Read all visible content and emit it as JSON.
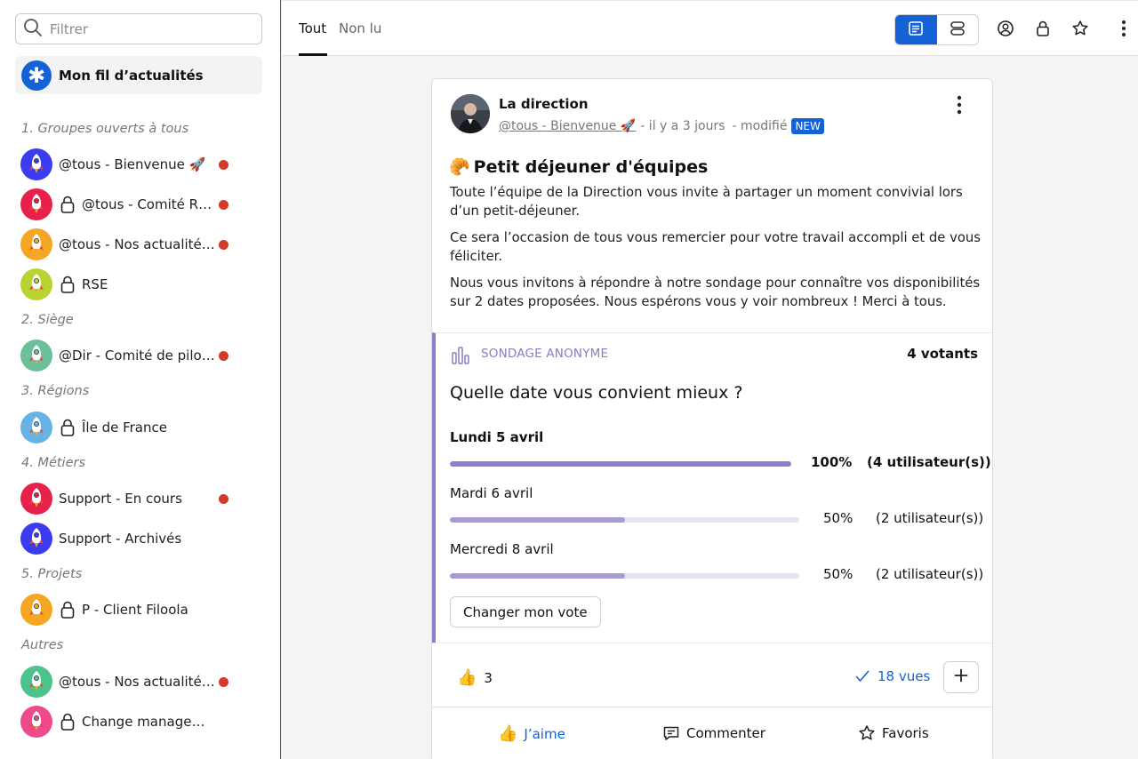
{
  "sidebar": {
    "search_placeholder": "Filtrer",
    "feed_label": "Mon fil d’actualités",
    "sections": [
      {
        "title": "1. Groupes ouverts à tous"
      },
      {
        "title": "2. Siège"
      },
      {
        "title": "3. Régions"
      },
      {
        "title": "4. Métiers"
      },
      {
        "title": "5. Projets"
      },
      {
        "title": "Autres"
      }
    ],
    "groups": [
      {
        "label": "@tous - Bienvenue 🚀",
        "color": "#3b3cf0",
        "locked": false,
        "unread": true
      },
      {
        "label": "@tous - Comité RH…",
        "color": "#e8214b",
        "locked": true,
        "unread": true
      },
      {
        "label": "@tous - Nos actualités …",
        "color": "#f5a623",
        "locked": false,
        "unread": true
      },
      {
        "label": "RSE",
        "color": "#b8d433",
        "locked": true,
        "unread": false
      },
      {
        "label": "@Dir - Comité de pilot…",
        "color": "#6bbf9a",
        "locked": false,
        "unread": true
      },
      {
        "label": "Île de France",
        "color": "#67b3e6",
        "locked": true,
        "unread": false
      },
      {
        "label": "Support - En cours",
        "color": "#e8214b",
        "locked": false,
        "unread": true
      },
      {
        "label": "Support - Archivés",
        "color": "#3b3cf0",
        "locked": false,
        "unread": false
      },
      {
        "label": "P - Client Filoola",
        "color": "#f5a623",
        "locked": true,
        "unread": false
      },
      {
        "label": "@tous - Nos actualités …",
        "color": "#4cc38a",
        "locked": false,
        "unread": true
      },
      {
        "label": "Change management",
        "color": "#ee4a8c",
        "locked": true,
        "unread": false
      }
    ]
  },
  "topbar": {
    "tabs": [
      {
        "label": "Tout"
      },
      {
        "label": "Non lu"
      }
    ],
    "accent": "#1462d6"
  },
  "post": {
    "author": "La direction",
    "channel": "@tous - Bienvenue 🚀",
    "time": "- il y a 3 jours",
    "modified": "- modifié",
    "badge": "NEW",
    "title_emoji": "🥐",
    "title": "Petit déjeuner d'équipes",
    "paragraphs": [
      "Toute l’équipe de la Direction vous invite à partager un moment convivial lors d’un petit-déjeuner.",
      "Ce sera l’occasion de tous vous remercier pour votre travail accompli et de vous féliciter.",
      "Nous vous invitons à répondre à notre sondage pour connaître vos disponibilités sur 2 dates proposées. Nous espérons vous y voir nombreux ! Merci à tous."
    ]
  },
  "poll": {
    "type_label": "SONDAGE ANONYME",
    "voters": "4 votants",
    "question": "Quelle date vous convient mieux ?",
    "options": [
      {
        "label": "Lundi 5 avril",
        "percent_text": "100%",
        "users": "(4 utilisateur(s))",
        "fraction": 1.0,
        "winner": true
      },
      {
        "label": "Mardi 6 avril",
        "percent_text": "50%",
        "users": "(2 utilisateur(s))",
        "fraction": 0.5,
        "winner": false
      },
      {
        "label": "Mercredi 8 avril",
        "percent_text": "50%",
        "users": "(2 utilisateur(s))",
        "fraction": 0.5,
        "winner": false
      }
    ],
    "change_vote_label": "Changer mon vote",
    "accent": "#8f7fc8"
  },
  "stats": {
    "likes_count": "3",
    "views": "18 vues"
  },
  "actions": {
    "like": "J’aime",
    "comment": "Commenter",
    "favorite": "Favoris"
  }
}
